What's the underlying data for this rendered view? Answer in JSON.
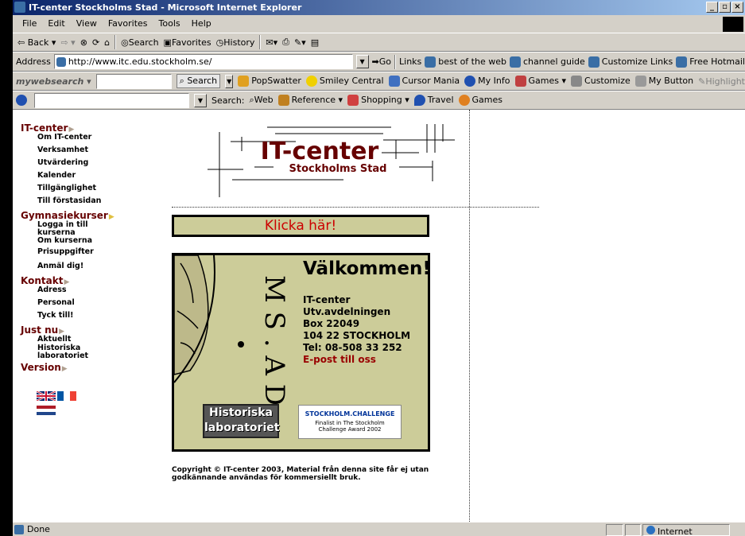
{
  "window": {
    "title": "IT-center Stockholms Stad - Microsoft Internet Explorer"
  },
  "menu": [
    "File",
    "Edit",
    "View",
    "Favorites",
    "Tools",
    "Help"
  ],
  "toolbar": {
    "back": "Back",
    "search": "Search",
    "favorites": "Favorites",
    "history": "History"
  },
  "address": {
    "label": "Address",
    "url": "http://www.itc.edu.stockholm.se/",
    "go": "Go",
    "links": "Links"
  },
  "links": [
    "best of the web",
    "channel guide",
    "Customize Links",
    "Free Hotmail"
  ],
  "websearch": {
    "brand": "mywebsearch",
    "search_btn": "Search",
    "items": [
      "PopSwatter",
      "Smiley Central",
      "Cursor Mania",
      "My Info",
      "Games",
      "Customize",
      "My Button",
      "Highlight"
    ]
  },
  "searchbar": {
    "label": "Search:",
    "items": [
      "Web",
      "Reference",
      "Shopping",
      "Travel",
      "Games"
    ]
  },
  "nav": [
    {
      "title": "IT-center",
      "items": [
        "Om IT-center",
        "Verksamhet",
        "Utvärdering",
        "Kalender",
        "Tillgänglighet",
        "Till förstasidan"
      ]
    },
    {
      "title": "Gymnasiekurser",
      "items": [
        "Logga in till kurserna",
        "Om kurserna",
        "Prisuppgifter",
        "Anmäl dig!"
      ]
    },
    {
      "title": "Kontakt",
      "items": [
        "Adress",
        "Personal",
        "Tyck till!"
      ]
    },
    {
      "title": "Just nu",
      "items": [
        "Aktuellt",
        "Historiska laboratoriet"
      ]
    },
    {
      "title": "Version",
      "items": []
    }
  ],
  "logo": {
    "line1": "IT-center",
    "line2": "Stockholms Stad"
  },
  "klicka": "Klicka här!",
  "welcome": {
    "heading": "Välkommen!",
    "lines": [
      "IT-center",
      "Utv.avdelningen",
      "Box 22049",
      "104 22 STOCKHOLM",
      "Tel: 08-508 33 252"
    ],
    "email": "E-post till oss",
    "seal_letters": "M S . A D"
  },
  "historiska": {
    "line1": "Historiska",
    "line2": "laboratoriet"
  },
  "challenge": {
    "logo": "STOCKHOLM.CHALLENGE",
    "line1": "Finalist in The Stockholm",
    "line2": "Challenge Award 2002"
  },
  "copyright": "Copyright © IT-center 2003, Material från denna site får ej utan godkännande användas för kommersiellt bruk.",
  "status": {
    "left": "Done",
    "zone": "Internet"
  }
}
